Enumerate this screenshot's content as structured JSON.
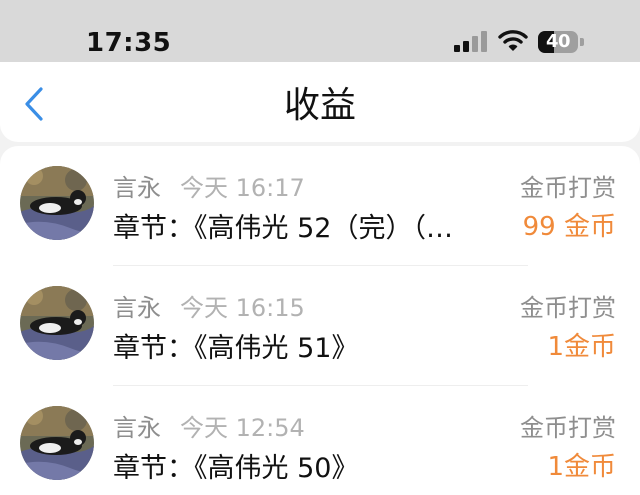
{
  "status_bar": {
    "time": "17:35",
    "battery_percent": "40",
    "battery_level": 0.4,
    "signal_bars_active": 2,
    "signal_bars_total": 4
  },
  "nav": {
    "title": "收益",
    "back_icon": "chevron-left-icon",
    "accent_color": "#3a8ee6"
  },
  "records": [
    {
      "name": "言永",
      "time": "今天 16:17",
      "type": "金币打赏",
      "chapter": "章节：《高伟光 52（完）（…",
      "amount": "99 金币"
    },
    {
      "name": "言永",
      "time": "今天 16:15",
      "type": "金币打赏",
      "chapter": "章节：《高伟光 51》",
      "amount": "1金币"
    },
    {
      "name": "言永",
      "time": "今天 12:54",
      "type": "金币打赏",
      "chapter": "章节：《高伟光 50》",
      "amount": "1金币"
    }
  ],
  "colors": {
    "amount": "#f08a3a",
    "secondary_text": "#8e8e8e",
    "timestamp": "#b2b2b2"
  }
}
